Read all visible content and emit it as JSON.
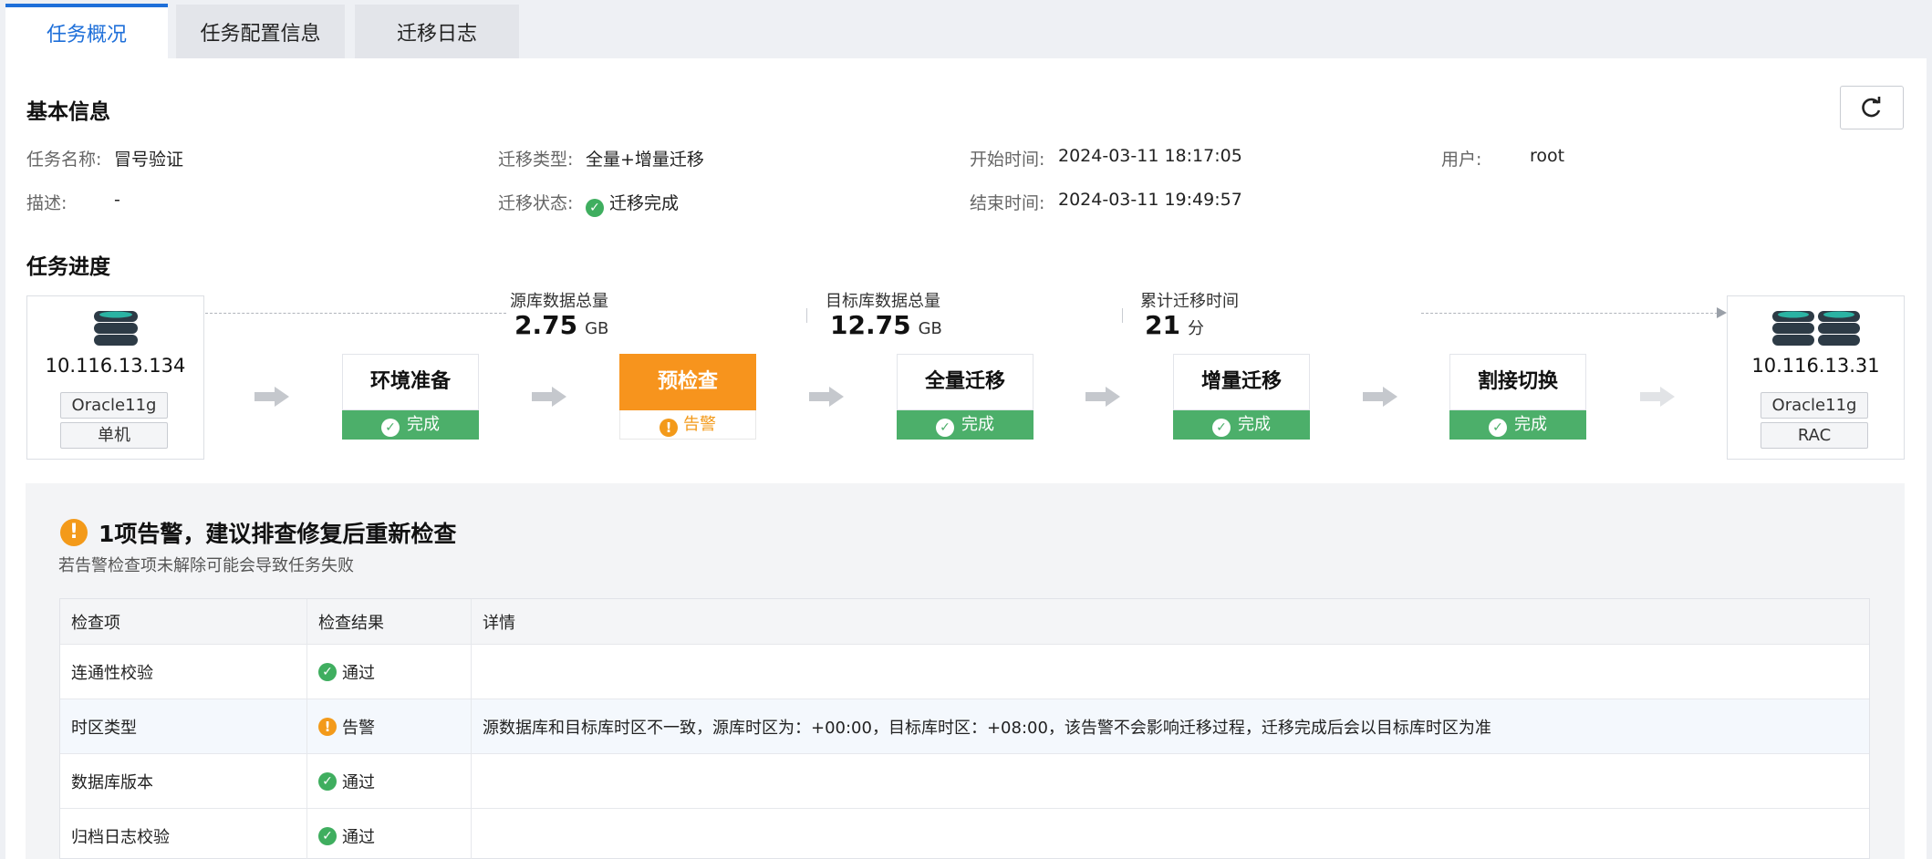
{
  "tabs": [
    {
      "label": "任务概况"
    },
    {
      "label": "任务配置信息"
    },
    {
      "label": "迁移日志"
    }
  ],
  "basic": {
    "title": "基本信息",
    "fields": {
      "name_label": "任务名称:",
      "name_value": "冒号验证",
      "type_label": "迁移类型:",
      "type_value": "全量+增量迁移",
      "start_label": "开始时间:",
      "start_value": "2024-03-11 18:17:05",
      "user_label": "用户:",
      "user_value": "root",
      "desc_label": "描述:",
      "desc_value": "-",
      "status_label": "迁移状态:",
      "status_value": "迁移完成",
      "end_label": "结束时间:",
      "end_value": "2024-03-11 19:49:57"
    }
  },
  "progress": {
    "title": "任务进度",
    "source": {
      "ip": "10.116.13.134",
      "db": "Oracle11g",
      "mode": "单机"
    },
    "target": {
      "ip": "10.116.13.31",
      "db": "Oracle11g",
      "mode": "RAC"
    },
    "metrics": [
      {
        "label": "源库数据总量",
        "value": "2.75",
        "unit": "GB"
      },
      {
        "label": "目标库数据总量",
        "value": "12.75",
        "unit": "GB"
      },
      {
        "label": "累计迁移时间",
        "value": "21",
        "unit": "分"
      }
    ],
    "steps": [
      {
        "name": "环境准备",
        "status": "完成"
      },
      {
        "name": "预检查",
        "status": "告警"
      },
      {
        "name": "全量迁移",
        "status": "完成"
      },
      {
        "name": "增量迁移",
        "status": "完成"
      },
      {
        "name": "割接切换",
        "status": "完成"
      }
    ]
  },
  "warning": {
    "title": "1项告警，建议排查修复后重新检查",
    "subtitle": "若告警检查项未解除可能会导致任务失败",
    "columns": [
      "检查项",
      "检查结果",
      "详情"
    ],
    "rows": [
      {
        "item": "连通性校验",
        "result": "通过",
        "detail": ""
      },
      {
        "item": "时区类型",
        "result": "告警",
        "detail": "源数据库和目标库时区不一致，源库时区为：+00:00，目标库时区：+08:00，该告警不会影响迁移过程，迁移完成后会以目标库时区为准"
      },
      {
        "item": "数据库版本",
        "result": "通过",
        "detail": ""
      },
      {
        "item": "归档日志校验",
        "result": "通过",
        "detail": ""
      }
    ]
  },
  "colors": {
    "accent": "#1e6fd9",
    "success": "#4caf6a",
    "warning": "#f39a1a"
  },
  "icons": [
    "refresh-icon",
    "check-circle-icon",
    "warning-circle-icon",
    "database-icon",
    "arrow-right-icon"
  ]
}
